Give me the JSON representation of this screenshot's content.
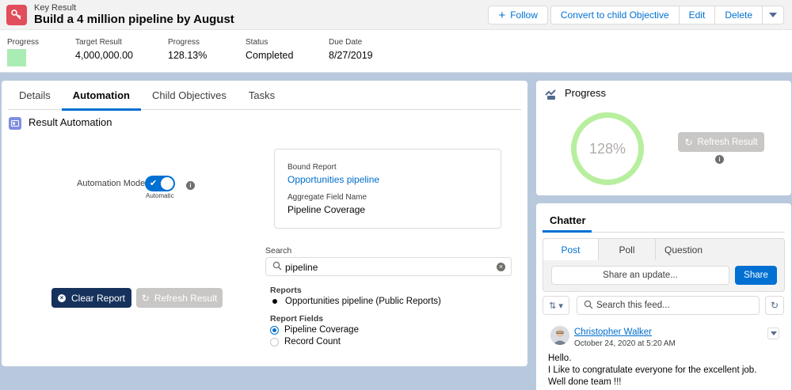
{
  "header": {
    "type_label": "Key Result",
    "title": "Build a 4 million pipeline by August",
    "buttons": {
      "follow": "Follow",
      "convert": "Convert to child Objective",
      "edit": "Edit",
      "delete": "Delete"
    },
    "fields": {
      "progress_label": "Progress",
      "progress_color": "#a9ecb4",
      "target_label": "Target Result",
      "target_value": "4,000,000.00",
      "progress2_label": "Progress",
      "progress2_value": "128.13%",
      "status_label": "Status",
      "status_value": "Completed",
      "due_label": "Due Date",
      "due_value": "8/27/2019"
    }
  },
  "tabs": [
    "Details",
    "Automation",
    "Child Objectives",
    "Tasks"
  ],
  "active_tab": "Automation",
  "automation": {
    "section_title": "Result Automation",
    "mode_label": "Automation Mode",
    "mode_value": "Automatic",
    "bound_report_label": "Bound Report",
    "bound_report_value": "Opportunities pipeline",
    "aggregate_label": "Aggregate Field Name",
    "aggregate_value": "Pipeline Coverage",
    "search_label": "Search",
    "search_value": "pipeline",
    "reports_label": "Reports",
    "reports": [
      "Opportunities pipeline (Public Reports)"
    ],
    "report_fields_label": "Report Fields",
    "report_fields": [
      {
        "label": "Pipeline Coverage",
        "selected": true
      },
      {
        "label": "Record Count",
        "selected": false
      }
    ],
    "clear_button": "Clear Report",
    "refresh_button": "Refresh Result"
  },
  "progress_card": {
    "title": "Progress",
    "percent_text": "128%",
    "refresh_button": "Refresh Result"
  },
  "chatter": {
    "title": "Chatter",
    "publisher_tabs": [
      "Post",
      "Poll",
      "Question"
    ],
    "share_placeholder": "Share an update...",
    "share_button": "Share",
    "search_placeholder": "Search this feed...",
    "post": {
      "author": "Christopher Walker",
      "date": "October 24, 2020 at 5:20 AM",
      "lines": [
        "Hello.",
        "I Like to congratulate everyone for the excellent job.",
        "Well done team !!!"
      ]
    }
  },
  "colors": {
    "accent": "#0070d2",
    "brand_dark": "#16325c",
    "object_icon": "#e24d5b",
    "ring": "#b8ef9f"
  }
}
